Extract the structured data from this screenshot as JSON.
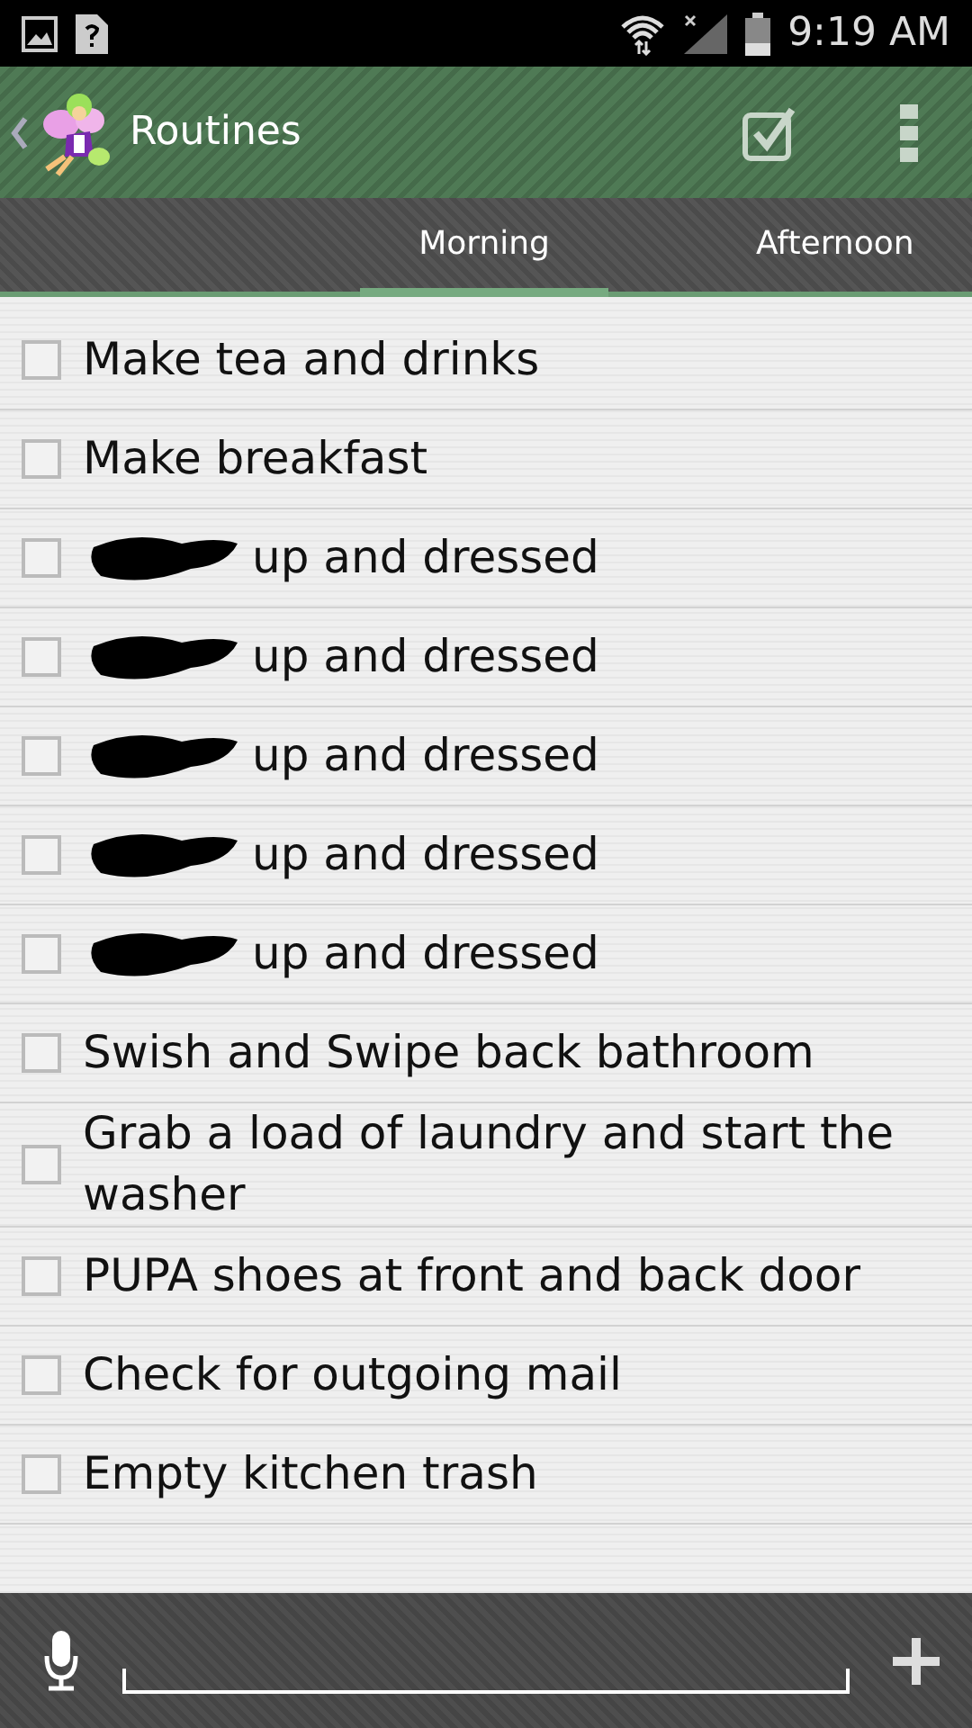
{
  "status_bar": {
    "time": "9:19 AM"
  },
  "app_bar": {
    "title": "Routines"
  },
  "tabs": [
    {
      "label": "Morning",
      "selected": true
    },
    {
      "label": "Afternoon",
      "selected": false
    }
  ],
  "items": [
    {
      "kind": "plain",
      "text": "Make tea and drinks",
      "checked": false
    },
    {
      "kind": "plain",
      "text": "Make breakfast",
      "checked": false
    },
    {
      "kind": "redacted",
      "text": "up and dressed",
      "checked": false
    },
    {
      "kind": "redacted",
      "text": "up and dressed",
      "checked": false
    },
    {
      "kind": "redacted",
      "text": "up and dressed",
      "checked": false
    },
    {
      "kind": "redacted",
      "text": "up and dressed",
      "checked": false
    },
    {
      "kind": "redacted",
      "text": "up and dressed",
      "checked": false
    },
    {
      "kind": "plain",
      "text": "Swish and Swipe back bathroom",
      "checked": false
    },
    {
      "kind": "plain",
      "text": "Grab a load of laundry and start the washer",
      "checked": false
    },
    {
      "kind": "plain",
      "text": "PUPA shoes at front and back door",
      "checked": false
    },
    {
      "kind": "plain",
      "text": "Check for outgoing mail",
      "checked": false
    },
    {
      "kind": "plain",
      "text": "Empty kitchen trash",
      "checked": false
    }
  ]
}
